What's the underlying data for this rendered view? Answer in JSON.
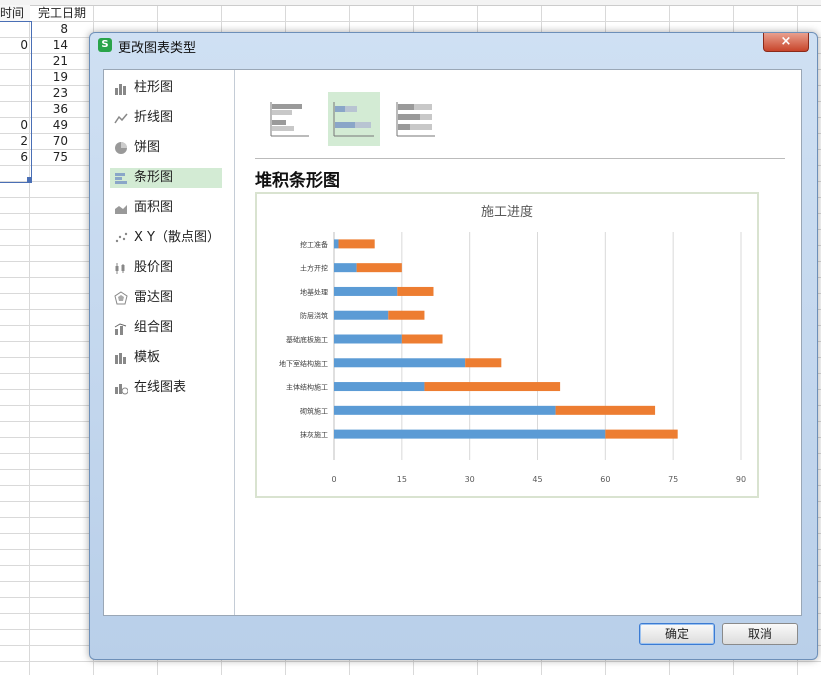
{
  "sheet": {
    "header_a": "时间",
    "header_b": "完工日期",
    "col_a": [
      "",
      "0",
      "",
      "",
      "",
      "",
      "0",
      "2",
      "6"
    ],
    "col_b": [
      "8",
      "14",
      "21",
      "19",
      "23",
      "36",
      "49",
      "70",
      "75"
    ]
  },
  "dialog": {
    "title": "更改图表类型",
    "close_label": "×",
    "nav": [
      {
        "label": "柱形图",
        "icon": "column-chart-icon"
      },
      {
        "label": "折线图",
        "icon": "line-chart-icon"
      },
      {
        "label": "饼图",
        "icon": "pie-chart-icon"
      },
      {
        "label": "条形图",
        "icon": "bar-chart-icon"
      },
      {
        "label": "面积图",
        "icon": "area-chart-icon"
      },
      {
        "label": "X Y（散点图）",
        "icon": "scatter-chart-icon"
      },
      {
        "label": "股价图",
        "icon": "stock-chart-icon"
      },
      {
        "label": "雷达图",
        "icon": "radar-chart-icon"
      },
      {
        "label": "组合图",
        "icon": "combo-chart-icon"
      },
      {
        "label": "模板",
        "icon": "template-icon"
      },
      {
        "label": "在线图表",
        "icon": "online-chart-icon"
      }
    ],
    "active_nav": "条形图",
    "section_title": "堆积条形图",
    "ok_label": "确定",
    "cancel_label": "取消",
    "colors": {
      "series1": "#5b9bd5",
      "series2": "#ed7d31",
      "active_bg": "#d3ebd4"
    }
  },
  "chart_data": {
    "type": "bar",
    "orientation": "horizontal",
    "stacked": true,
    "title": "施工进度",
    "categories": [
      "挖工准备",
      "土方开挖",
      "地基处理",
      "防层浇筑",
      "基础底板施工",
      "地下室结构施工",
      "主体结构施工",
      "砌筑施工",
      "抹灰施工"
    ],
    "series": [
      {
        "values": [
          1,
          5,
          14,
          12,
          15,
          29,
          20,
          49,
          60
        ]
      },
      {
        "values": [
          8,
          10,
          8,
          8,
          9,
          8,
          30,
          22,
          16
        ]
      }
    ],
    "xlim": [
      0,
      90
    ],
    "x_ticks": [
      "0",
      "15",
      "30",
      "45",
      "60",
      "75",
      "90"
    ],
    "grid": true,
    "legend": "none"
  }
}
